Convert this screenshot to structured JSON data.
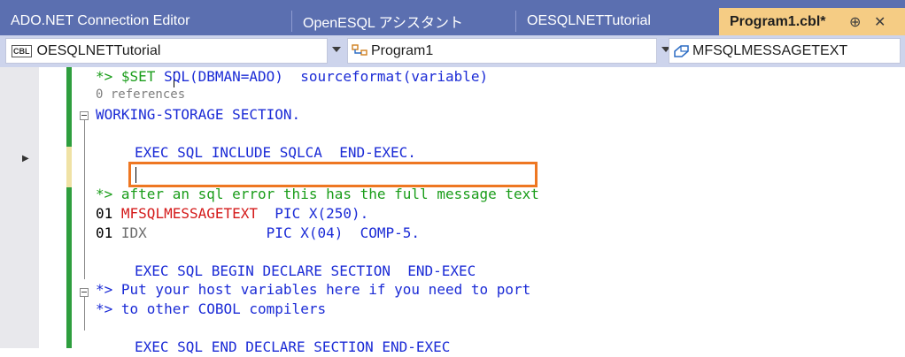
{
  "tabs": [
    {
      "label": "ADO.NET Connection Editor"
    },
    {
      "label": "OpenESQL アシスタント"
    },
    {
      "label": "OESQLNETTutorial"
    },
    {
      "label": "Program1.cbl*",
      "pin": "⊕",
      "close": "✕"
    }
  ],
  "nav": {
    "project": "OESQLNETTutorial",
    "project_icon": "CBL",
    "program": "Program1",
    "member": "MFSQLMESSAGETEXT"
  },
  "code": {
    "l1a": "*> $SET ",
    "l1b": "SQL(DBMAN=ADO)  sourceformat(variable)",
    "refs": "0 references",
    "l3": "WORKING-STORAGE SECTION.",
    "l5": "EXEC SQL INCLUDE SQLCA  END-EXEC.",
    "l7": "*> after an sql error this has the full message text",
    "l8a": "01 ",
    "l8b": "MFSQLMESSAGETEXT",
    "l8c": "  PIC X(250).",
    "l9a": "01 ",
    "l9b": "IDX",
    "l9c": "              PIC X(04)  COMP-5.",
    "l11": "EXEC SQL BEGIN DECLARE SECTION  END-EXEC",
    "l12": "*> Put your host variables here if you need to port",
    "l13": "*> to other COBOL compilers",
    "l15": "EXEC SQL END DECLARE SECTION END-EXEC"
  }
}
